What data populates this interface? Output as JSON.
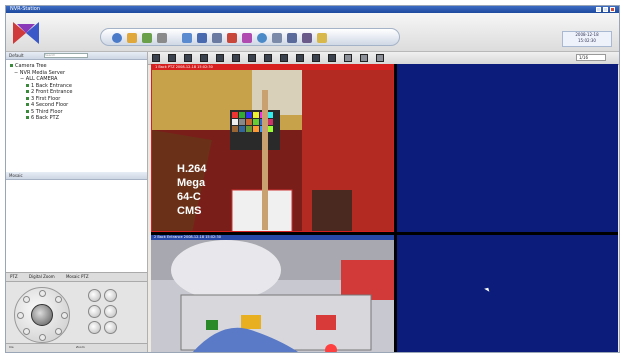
{
  "window": {
    "title": "NVR-Station"
  },
  "toolbar": {
    "date_line1": "2008-12-18",
    "date_line2": "15:02:30"
  },
  "camera_tree": {
    "tab_label": "Default",
    "search_placeholder": "Search",
    "title": "Camera Tree",
    "device": "NVR Media Server",
    "all_label": "ALL CAMERA",
    "items": [
      "1 Back Entrance",
      "2 Front Entrance",
      "3 First Floor",
      "4 Second Floor",
      "5 Third Floor",
      "6 Back PTZ"
    ]
  },
  "panel2": {
    "title": "Mosaic"
  },
  "ptz": {
    "tabs": [
      "PTZ",
      "Digital Zoom",
      "Mosaic PTZ"
    ],
    "bottom_left": "Iris",
    "bottom_right": "Zoom"
  },
  "layout_bar": {
    "right_label": "1/16"
  },
  "video": {
    "cell1_header": "1 Back PTZ  2008-12-18 15:02:30",
    "cell3_header": "2 Back Entrance  2008-12-18 15:02:30",
    "overlay_lines": [
      "H.264",
      "Mega",
      "64-C",
      "CMS"
    ]
  },
  "colors": {
    "title_blue": "#1e4a9e",
    "empty_cell": "#0c1c7a",
    "active_border": "#d62020"
  }
}
